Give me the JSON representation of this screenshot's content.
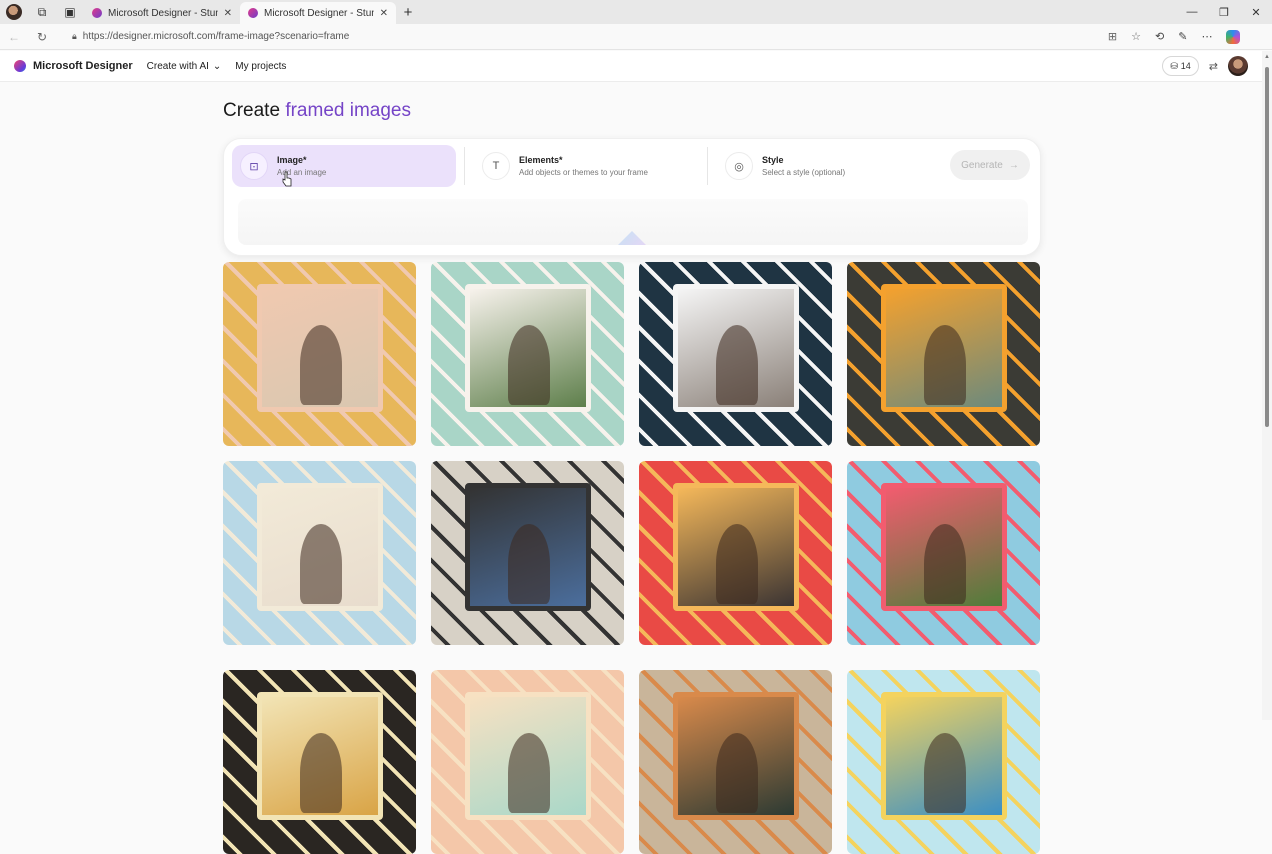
{
  "browser": {
    "tabs": [
      {
        "title": "Microsoft Designer - Stunning de",
        "active": false
      },
      {
        "title": "Microsoft Designer - Stunning de",
        "active": true
      }
    ],
    "url": "https://designer.microsoft.com/frame-image?scenario=frame"
  },
  "header": {
    "brand": "Microsoft Designer",
    "create_menu": "Create with AI",
    "my_projects": "My projects",
    "credits": "14"
  },
  "page": {
    "title_prefix": "Create",
    "title_accent": "framed images"
  },
  "prompt": {
    "steps": [
      {
        "title": "Image*",
        "subtitle": "Add an image",
        "icon": "image-icon"
      },
      {
        "title": "Elements*",
        "subtitle": "Add objects or themes to your frame",
        "icon": "elements-icon"
      },
      {
        "title": "Style",
        "subtitle": "Select a style (optional)",
        "icon": "style-icon"
      }
    ],
    "generate_label": "Generate"
  },
  "gallery": [
    {
      "name": "floral-frame-man-laptop",
      "bg": "#e7b75a",
      "inner": "#d9c7b0",
      "accent": "#f0c9b0"
    },
    {
      "name": "paper-flower-frame-wedding",
      "bg": "#a9d5c7",
      "inner": "#5e7f4b",
      "accent": "#f7f2ec"
    },
    {
      "name": "tools-frame-child-drawing",
      "bg": "#1f3443",
      "inner": "#8a8078",
      "accent": "#f5f5f5"
    },
    {
      "name": "vegetable-frame-dinner",
      "bg": "#3b3b35",
      "inner": "#6c8a7d",
      "accent": "#f4a12e"
    },
    {
      "name": "venice-frame-woman",
      "bg": "#b8d8e6",
      "inner": "#e8dccd",
      "accent": "#f2ead8"
    },
    {
      "name": "tech-frame-sewing-man",
      "bg": "#d7d1c6",
      "inner": "#4b6e9d",
      "accent": "#333333"
    },
    {
      "name": "colorful-blocks-frame-portrait",
      "bg": "#e94a45",
      "inner": "#3b3433",
      "accent": "#f5b85a"
    },
    {
      "name": "party-frame-boy",
      "bg": "#8fcbe0",
      "inner": "#4f7d3a",
      "accent": "#f25c6f"
    },
    {
      "name": "music-frame",
      "bg": "#2a2622",
      "inner": "#d9a446",
      "accent": "#f2e4b5"
    },
    {
      "name": "pastel-shapes-frame",
      "bg": "#f4c7a9",
      "inner": "#a9d8c9",
      "accent": "#f7e1c2"
    },
    {
      "name": "leaves-frame",
      "bg": "#c9b59a",
      "inner": "#2c3a33",
      "accent": "#d98a4b"
    },
    {
      "name": "graduation-frame",
      "bg": "#bfe6ee",
      "inner": "#3b8fc4",
      "accent": "#f4d35e"
    }
  ]
}
